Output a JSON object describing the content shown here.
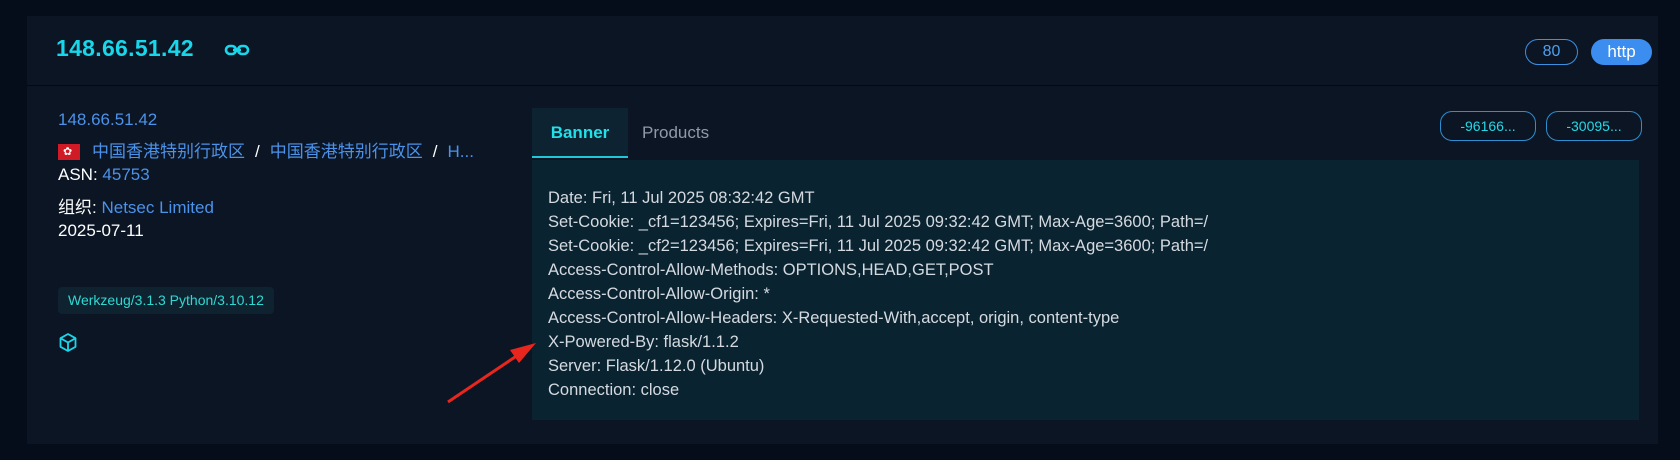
{
  "header": {
    "ip": "148.66.51.42",
    "port": "80",
    "protocol": "http"
  },
  "info": {
    "ip": "148.66.51.42",
    "location": {
      "region1": "中国香港特别行政区",
      "separator": "/",
      "region2": "中国香港特别行政区",
      "region3": "H..."
    },
    "asn_label": "ASN:",
    "asn": "45753",
    "org_label": "组织:",
    "org": "Netsec Limited",
    "date": "2025-07-11",
    "tag": "Werkzeug/3.1.3 Python/3.10.12"
  },
  "tabs": {
    "banner": "Banner",
    "products": "Products"
  },
  "hashes": [
    "-96166...",
    "-30095..."
  ],
  "banner": {
    "lines": [
      "Date: Fri, 11 Jul 2025 08:32:42 GMT",
      "Set-Cookie: _cf1=123456; Expires=Fri, 11 Jul 2025 09:32:42 GMT; Max-Age=3600; Path=/",
      "Set-Cookie: _cf2=123456; Expires=Fri, 11 Jul 2025 09:32:42 GMT; Max-Age=3600; Path=/",
      "Access-Control-Allow-Methods: OPTIONS,HEAD,GET,POST",
      "Access-Control-Allow-Origin: *",
      "Access-Control-Allow-Headers: X-Requested-With,accept, origin, content-type",
      "X-Powered-By: flask/1.1.2",
      "Server: Flask/1.12.0 (Ubuntu)",
      "Connection: close"
    ]
  },
  "icons": {
    "link": "link-icon",
    "flag": "hong-kong-flag-icon",
    "cube": "cube-icon",
    "annotation": "red-arrow"
  },
  "colors": {
    "accent": "#19d7ea",
    "link": "#4b92ea",
    "protocol_badge": "#3b8ef0",
    "arrow": "#e8261e"
  }
}
